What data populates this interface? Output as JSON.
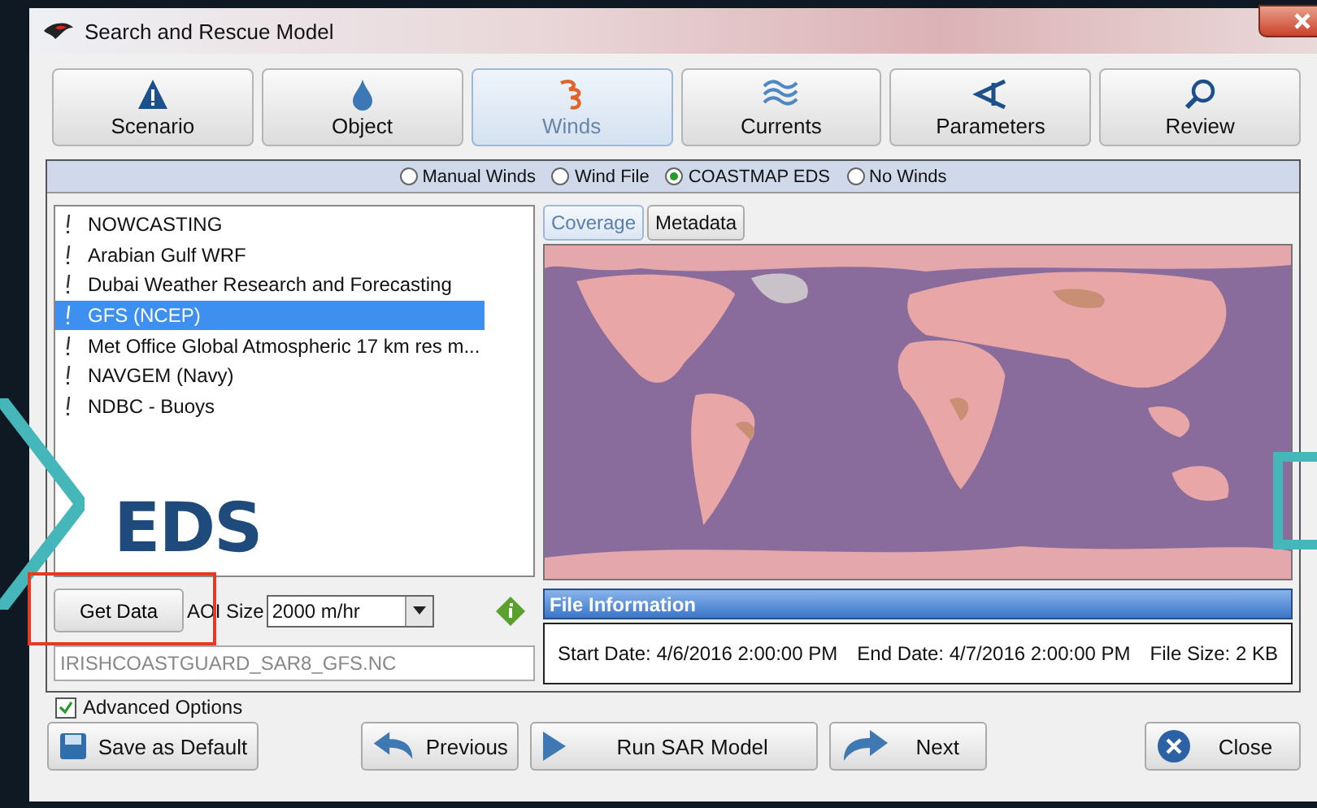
{
  "window": {
    "title": "Search and Rescue Model"
  },
  "tabs": [
    {
      "label": "Scenario",
      "selected": false
    },
    {
      "label": "Object",
      "selected": false
    },
    {
      "label": "Winds",
      "selected": true
    },
    {
      "label": "Currents",
      "selected": false
    },
    {
      "label": "Parameters",
      "selected": false
    },
    {
      "label": "Review",
      "selected": false
    }
  ],
  "wind_sources": [
    {
      "label": "Manual Winds",
      "selected": false
    },
    {
      "label": "Wind File",
      "selected": false
    },
    {
      "label": "COASTMAP EDS",
      "selected": true
    },
    {
      "label": "No Winds",
      "selected": false
    }
  ],
  "datasets": [
    {
      "label": "NOWCASTING",
      "selected": false
    },
    {
      "label": "Arabian Gulf WRF",
      "selected": false
    },
    {
      "label": "Dubai Weather Research and Forecasting",
      "selected": false
    },
    {
      "label": "GFS (NCEP)",
      "selected": true
    },
    {
      "label": "Met Office Global Atmospheric 17 km res m...",
      "selected": false
    },
    {
      "label": "NAVGEM (Navy)",
      "selected": false
    },
    {
      "label": "NDBC - Buoys",
      "selected": false
    }
  ],
  "get_data_button": "Get Data",
  "aoi_size": {
    "label": "AOI Size",
    "value": "2000 m/hr"
  },
  "file_name": {
    "value": "IRISHCOASTGUARD_SAR8_GFS.NC",
    "disabled": true
  },
  "map_tabs": [
    {
      "label": "Coverage",
      "selected": true
    },
    {
      "label": "Metadata",
      "selected": false
    }
  ],
  "map": {
    "kind": "picture"
  },
  "file_information": {
    "title": "File Information",
    "start_date": "Start Date: 4/6/2016 2:00:00 PM",
    "end_date": "End Date: 4/7/2016 2:00:00 PM",
    "file_size": "File Size: 2 KB"
  },
  "advanced_options": {
    "label": "Advanced Options",
    "checked": true
  },
  "buttons": [
    "Save as Default",
    "Previous",
    "Run SAR Model",
    "Next",
    "Close"
  ],
  "annotation": {
    "label": "EDS"
  }
}
